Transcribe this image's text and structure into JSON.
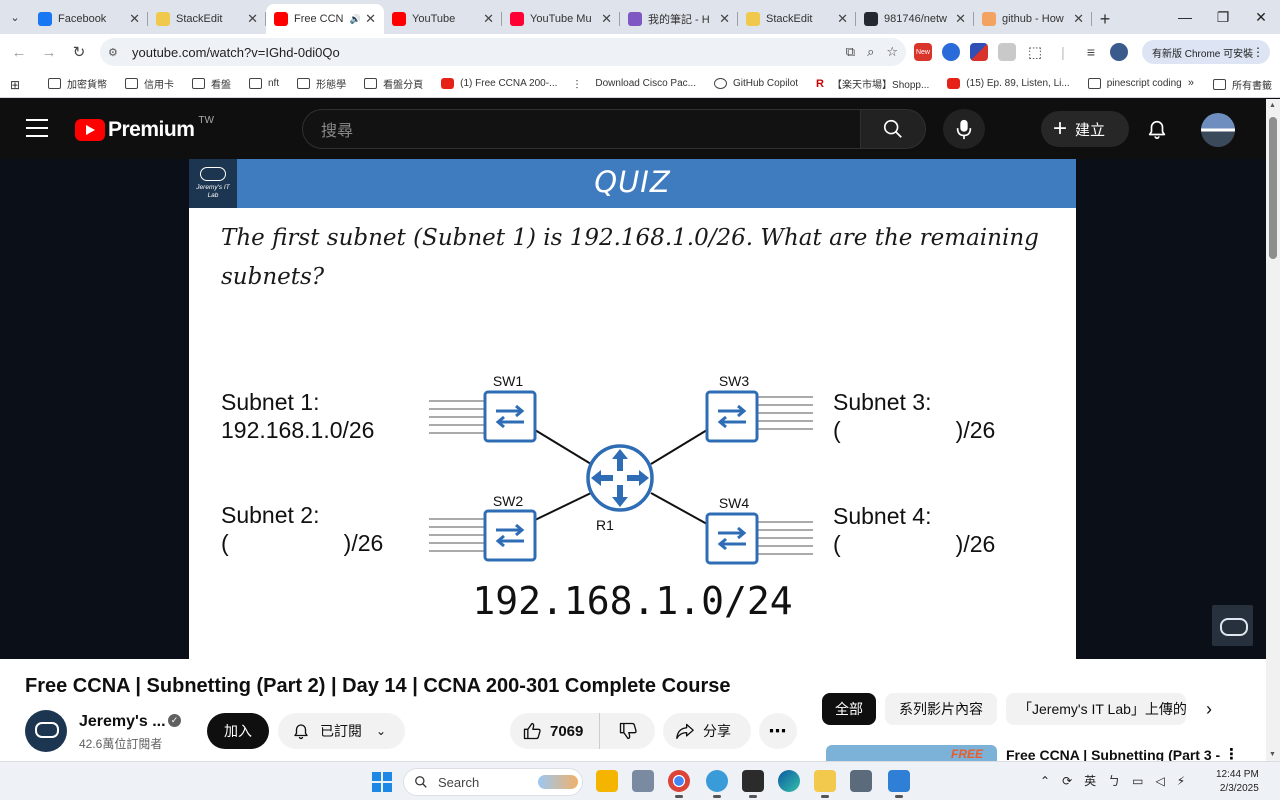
{
  "browser": {
    "tabs": [
      {
        "title": "Facebook",
        "favicon_color": "#1877f2"
      },
      {
        "title": "StackEdit",
        "favicon_color": "#f0c94c"
      },
      {
        "title": "Free CCN",
        "favicon_color": "#ff0000",
        "active": true,
        "audio": true
      },
      {
        "title": "YouTube",
        "favicon_color": "#ff0000"
      },
      {
        "title": "YouTube Mu",
        "favicon_color": "#ff0033"
      },
      {
        "title": "我的筆記 - H",
        "favicon_color": "#7e57c2"
      },
      {
        "title": "StackEdit",
        "favicon_color": "#f0c94c"
      },
      {
        "title": "981746/netw",
        "favicon_color": "#24292f"
      },
      {
        "title": "github - How",
        "favicon_color": "#f4a261"
      }
    ],
    "url": "youtube.com/watch?v=IGhd-0di0Qo",
    "update_label": "有新版 Chrome 可安裝",
    "ext_new_badge": "New",
    "bookmarks": [
      {
        "label": "加密貨幣",
        "icon": "folder-icon"
      },
      {
        "label": "信用卡",
        "icon": "folder-icon"
      },
      {
        "label": "看盤",
        "icon": "folder-icon"
      },
      {
        "label": "nft",
        "icon": "folder-icon"
      },
      {
        "label": "形態學",
        "icon": "folder-icon"
      },
      {
        "label": "看盤分頁",
        "icon": "folder-icon"
      },
      {
        "label": "(1) Free CCNA 200-...",
        "icon": "youtube-icon"
      },
      {
        "label": "Download Cisco Pac...",
        "icon": "cisco-icon"
      },
      {
        "label": "GitHub Copilot",
        "icon": "github-icon"
      },
      {
        "label": "【楽天市場】Shopp...",
        "icon": "rakuten-icon"
      },
      {
        "label": "(15) Ep. 89, Listen, Li...",
        "icon": "youtube-icon"
      },
      {
        "label": "pinescript coding",
        "icon": "folder-icon"
      }
    ],
    "bookmarks_more": "»",
    "all_bookmarks": "所有書籤"
  },
  "youtube": {
    "logo_word": "Premium",
    "region": "TW",
    "search_placeholder": "搜尋",
    "create_label": "建立"
  },
  "slide": {
    "header": "QUIZ",
    "brand": "Jeremy's IT Lab",
    "question": "The first subnet (Subnet 1) is 192.168.1.0/26.  What are the remaining subnets?",
    "subnet1_label": "Subnet 1:",
    "subnet1_value": "192.168.1.0/26",
    "subnet2_label": "Subnet 2:",
    "subnet2_value": "(                  )/26",
    "subnet3_label": "Subnet 3:",
    "subnet3_value": "(                  )/26",
    "subnet4_label": "Subnet 4:",
    "subnet4_value": "(                  )/26",
    "sw1": "SW1",
    "sw2": "SW2",
    "sw3": "SW3",
    "sw4": "SW4",
    "r1": "R1",
    "network": "192.168.1.0/24"
  },
  "video": {
    "title": "Free CCNA | Subnetting (Part 2) | Day 14 | CCNA 200-301 Complete Course",
    "channel": "Jeremy's ...",
    "subscribers": "42.6萬位訂閱者",
    "join_label": "加入",
    "subscribed_label": "已訂閱",
    "likes": "7069",
    "share_label": "分享"
  },
  "sidebar": {
    "chips": [
      "全部",
      "系列影片內容",
      "「Jeremy's IT Lab」上傳的"
    ],
    "rec_thumb_text": "FREE",
    "rec_title": "Free CCNA | Subnetting (Part 3 -"
  },
  "taskbar": {
    "search_label": "Search",
    "ime": "英",
    "time": "12:44 PM",
    "date": "2/3/2025"
  }
}
